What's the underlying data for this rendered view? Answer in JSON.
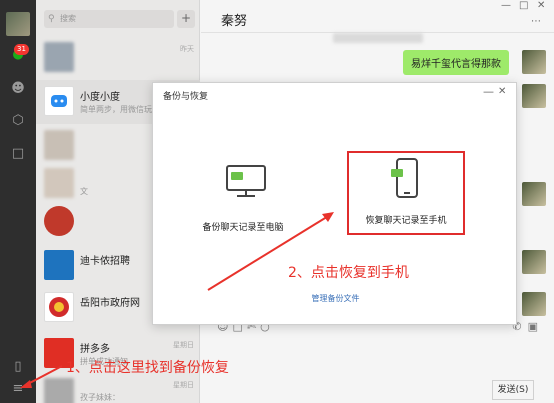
{
  "rail": {
    "unread_badge": "31"
  },
  "search": {
    "placeholder": "搜索"
  },
  "chat_list": [
    {
      "name": "",
      "preview": "",
      "time": "昨天",
      "avatar_color": "#9aa5b0"
    },
    {
      "name": "小度小度",
      "preview": "简单两步，用微信玩转...",
      "time": "",
      "avatar_color": "#ffffff"
    },
    {
      "name": "",
      "preview": "",
      "time": "",
      "avatar_color": "#c8bfb5"
    },
    {
      "name": "",
      "preview": "文",
      "time": "",
      "avatar_color": "#d2c7bc"
    },
    {
      "name": "",
      "preview": "",
      "time": "",
      "avatar_color": "#c0392b"
    },
    {
      "name": "迪卡侬招聘",
      "preview": "",
      "time": "",
      "avatar_color": "#1e73be"
    },
    {
      "name": "岳阳市政府网",
      "preview": "",
      "time": "",
      "avatar_color": "#ffffff"
    },
    {
      "name": "拼多多",
      "preview": "拼单成功通知",
      "time": "星期日",
      "avatar_color": "#e02e24"
    },
    {
      "name": "",
      "preview": "孜子妹妹：",
      "time": "星期日",
      "avatar_color": "#aaaaaa"
    }
  ],
  "chat": {
    "title": "秦努",
    "message": "易烊千玺代言得那款",
    "send_label": "发送(S)"
  },
  "dialog": {
    "title": "备份与恢复",
    "backup_label": "备份聊天记录至电脑",
    "restore_label": "恢复聊天记录至手机",
    "manage_label": "管理备份文件"
  },
  "annotations": {
    "step1": "1、点击这里找到备份恢复",
    "step2": "2、点击恢复到手机"
  },
  "colors": {
    "accent_green": "#1aad19",
    "bubble_green": "#9eea6a",
    "annotation_red": "#e8322b"
  }
}
